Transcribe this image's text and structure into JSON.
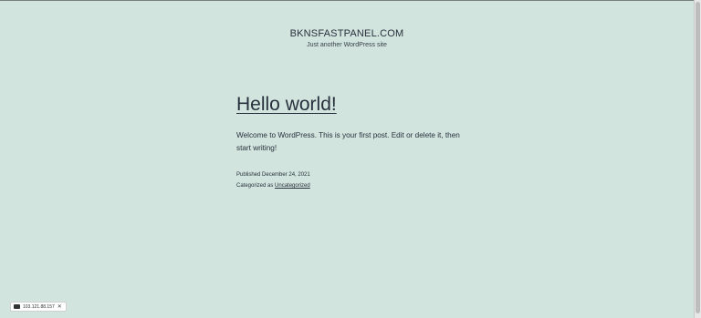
{
  "site": {
    "title": "BKNSFASTPANEL.COM",
    "tagline": "Just another WordPress site"
  },
  "post": {
    "title": "Hello world!",
    "content": "Welcome to WordPress. This is your first post. Edit or delete it, then start writing!",
    "published": "Published December 24, 2021",
    "categorized_prefix": "Categorized as ",
    "category": "Uncategorized"
  },
  "overlay": {
    "ip_address": "103.121.88.157",
    "close_symbol": "✕"
  },
  "colors": {
    "background": "#d1e4dd",
    "text": "#28303d"
  }
}
